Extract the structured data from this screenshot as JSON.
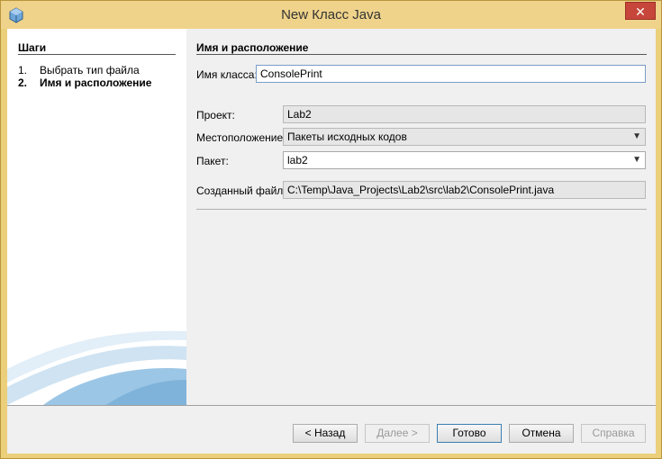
{
  "window": {
    "title": "New Класс Java",
    "close_label": "✕"
  },
  "steps": {
    "title": "Шаги",
    "items": [
      {
        "num": "1.",
        "label": "Выбрать тип файла"
      },
      {
        "num": "2.",
        "label": "Имя и расположение"
      }
    ]
  },
  "form": {
    "title": "Имя и расположение",
    "class_name_label": "Имя класса:",
    "class_name_value": "ConsolePrint",
    "project_label": "Проект:",
    "project_value": "Lab2",
    "location_label": "Местоположение:",
    "location_value": "Пакеты исходных кодов",
    "package_label": "Пакет:",
    "package_value": "lab2",
    "created_file_label": "Созданный файл:",
    "created_file_value": "C:\\Temp\\Java_Projects\\Lab2\\src\\lab2\\ConsolePrint.java"
  },
  "buttons": {
    "back": "< Назад",
    "next": "Далее >",
    "finish": "Готово",
    "cancel": "Отмена",
    "help": "Справка"
  },
  "colors": {
    "title_bar": "#efd38a",
    "close": "#c7463b",
    "swoosh": "#7fb3d9"
  }
}
